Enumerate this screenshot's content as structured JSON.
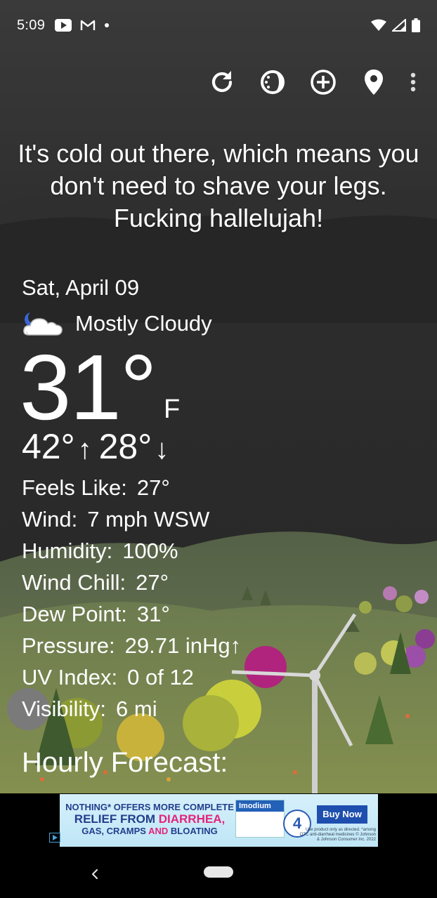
{
  "status_bar": {
    "time": "5:09",
    "left_icons": [
      "youtube-icon",
      "gmail-icon",
      "dot-icon"
    ],
    "right_icons": [
      "wifi-icon",
      "cell-signal-icon",
      "battery-icon"
    ]
  },
  "toolbar": {
    "buttons": [
      "refresh-icon",
      "theme-icon",
      "add-location-icon",
      "location-pin-icon",
      "more-vert-icon"
    ]
  },
  "quote": "It's cold out there, which means you don't need to shave your legs. Fucking hallelujah!",
  "weather": {
    "date": "Sat, April 09",
    "condition": "Mostly Cloudy",
    "condition_icon": "partly-cloudy-night-icon",
    "temperature": "31°",
    "unit": "F",
    "high": "42°",
    "high_arrow": "↑",
    "low": "28°",
    "low_arrow": "↓",
    "stats": [
      {
        "label": "Feels Like:",
        "value": "27°"
      },
      {
        "label": "Wind:",
        "value": "7 mph WSW"
      },
      {
        "label": "Humidity:",
        "value": "100%"
      },
      {
        "label": "Wind Chill:",
        "value": "27°"
      },
      {
        "label": "Dew Point:",
        "value": "31°"
      },
      {
        "label": "Pressure:",
        "value": "29.71 inHg↑"
      },
      {
        "label": "UV Index:",
        "value": "0 of 12"
      },
      {
        "label": "Visibility:",
        "value": "6 mi"
      }
    ],
    "hourly_title": "Hourly Forecast:"
  },
  "ad": {
    "line1": "NOTHING* OFFERS MORE COMPLETE",
    "line2a": "RELIEF FROM",
    "line2b": "DIARRHEA,",
    "line3a": "GAS, CRAMPS",
    "line3b": "AND",
    "line3c": "BLOATING",
    "product": "Imodium",
    "badge": "4",
    "cta": "Buy Now",
    "fine_print": "Use product only as directed. *among OTC anti-diarrheal medicines © Johnson & Johnson Consumer Inc. 2022"
  },
  "colors": {
    "sky": "#2a2a2a",
    "hills": "#5d6b4a",
    "accent_purple": "#b0247d"
  }
}
